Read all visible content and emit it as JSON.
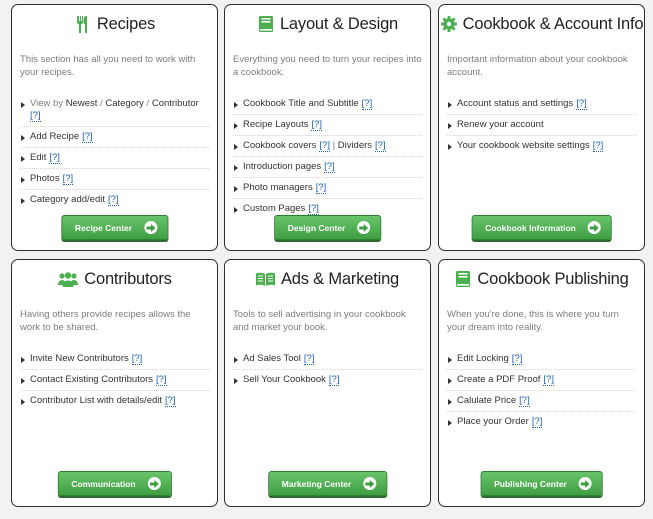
{
  "colors": {
    "accent": "#4caf50",
    "link": "#1a5fb4",
    "border": "#2e2e2e"
  },
  "help_marker": "[?]",
  "cards": {
    "recipes": {
      "title": "Recipes",
      "icon": "utensils-icon",
      "description": "This section has all you need to work with your recipes.",
      "view_by": {
        "prefix": "View by",
        "newest": "Newest",
        "sep1": "/",
        "category": "Category",
        "sep2": "/",
        "contributor": "Contributor"
      },
      "items": [
        "Add Recipe",
        "Edit",
        "Photos",
        "Category add/edit"
      ],
      "button": "Recipe Center"
    },
    "layout": {
      "title": "Layout & Design",
      "icon": "book-icon",
      "description": "Everything you need to turn your recipes into a cookbook.",
      "items": [
        "Cookbook Title and Subtitle",
        "Recipe Layouts"
      ],
      "covers": {
        "label": "Cookbook covers",
        "separator": "|",
        "dividers": "Dividers"
      },
      "items2": [
        "Introduction pages",
        "Photo managers",
        "Custom Pages"
      ],
      "button": "Design Center"
    },
    "account": {
      "title": "Cookbook & Account Info",
      "icon": "gear-icon",
      "description": "Important information about your cookbook account.",
      "items": [
        "Account status and settings",
        "Renew your account",
        "Your cookbook website settings"
      ],
      "button": "Cookbook Information"
    },
    "contributors": {
      "title": "Contributors",
      "icon": "users-icon",
      "description": "Having others provide recipes allows the work to be shared.",
      "items": [
        "Invite New Contributors",
        "Contact Existing Contributors",
        "Contributor List with details/edit"
      ],
      "button": "Communication"
    },
    "ads": {
      "title": "Ads & Marketing",
      "icon": "open-book-icon",
      "description": "Tools to sell advertising in your cookbook and market your book.",
      "items": [
        "Ad Sales Tool",
        "Sell Your Cookbook"
      ],
      "button": "Marketing Center"
    },
    "publishing": {
      "title": "Cookbook Publishing",
      "icon": "book-icon",
      "description": "When you're done, this is where you turn your dream into reality.",
      "items": [
        "Edit Locking",
        "Create a PDF Proof",
        "Calulate Price",
        "Place your Order"
      ],
      "button": "Publishing Center"
    }
  }
}
